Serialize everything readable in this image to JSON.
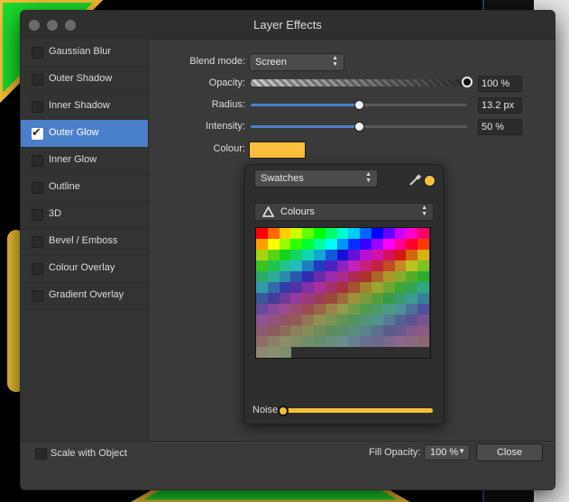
{
  "window": {
    "title": "Layer Effects"
  },
  "effects": [
    {
      "label": "Gaussian Blur",
      "checked": false
    },
    {
      "label": "Outer Shadow",
      "checked": false
    },
    {
      "label": "Inner Shadow",
      "checked": false
    },
    {
      "label": "Outer Glow",
      "checked": true
    },
    {
      "label": "Inner Glow",
      "checked": false
    },
    {
      "label": "Outline",
      "checked": false
    },
    {
      "label": "3D",
      "checked": false
    },
    {
      "label": "Bevel / Emboss",
      "checked": false
    },
    {
      "label": "Colour Overlay",
      "checked": false
    },
    {
      "label": "Gradient Overlay",
      "checked": false
    }
  ],
  "settings": {
    "blend_mode_label": "Blend mode:",
    "blend_mode_value": "Screen",
    "opacity_label": "Opacity:",
    "opacity_value": "100 %",
    "opacity_fraction": 1.0,
    "radius_label": "Radius:",
    "radius_value": "13.2 px",
    "radius_fraction": 0.5,
    "intensity_label": "Intensity:",
    "intensity_value": "50 %",
    "intensity_fraction": 0.5,
    "colour_label": "Colour:",
    "colour_hex": "#fbbf3d"
  },
  "colour_picker": {
    "mode_value": "Swatches",
    "palette_value": "Colours",
    "noise_label": "Noise",
    "noise_fraction": 0.0,
    "current_colour": "#fbbf3d"
  },
  "footer": {
    "scale_label": "Scale with Object",
    "scale_checked": false,
    "fill_opacity_label": "Fill Opacity:",
    "fill_opacity_value": "100 %",
    "close_label": "Close"
  },
  "colors": {
    "accent": "#4a7fc9",
    "glow": "#fbbf3d",
    "background_shape": "#18e02a"
  }
}
